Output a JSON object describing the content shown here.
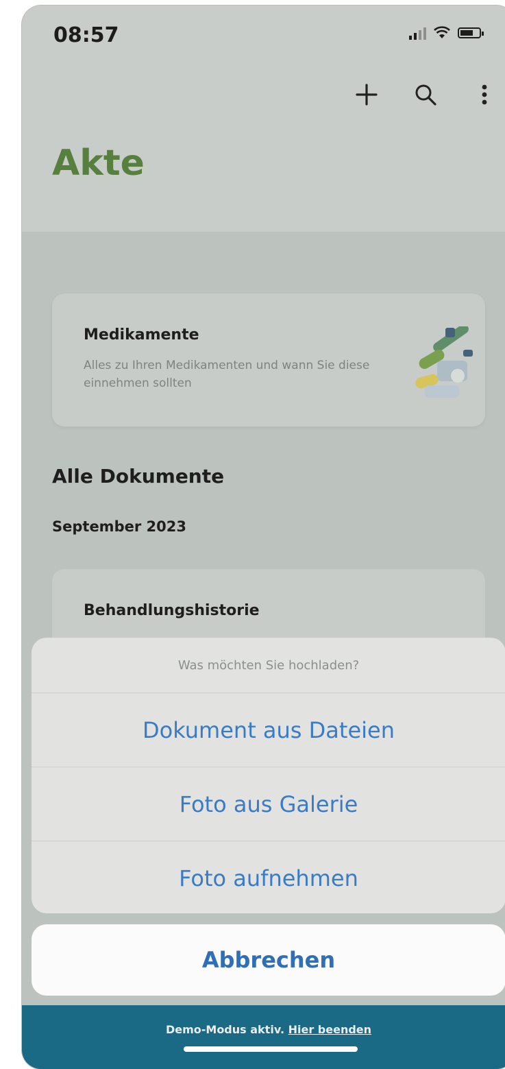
{
  "status_bar": {
    "time": "08:57"
  },
  "toolbar": {
    "add_icon": "plus-icon",
    "search_icon": "search-icon",
    "more_icon": "more-vertical-icon"
  },
  "page": {
    "title": "Akte",
    "title_color": "#577f3d"
  },
  "medication_card": {
    "title": "Medikamente",
    "description": "Alles zu Ihren Medikamenten und wann Sie diese einnehmen sollten",
    "illustration_icon": "pills-illustration"
  },
  "documents": {
    "section_title": "Alle Dokumente",
    "month": "September 2023",
    "items": [
      {
        "title": "Behandlungshistorie"
      }
    ]
  },
  "action_sheet": {
    "prompt": "Was möchten Sie hochladen?",
    "options": [
      {
        "label": "Dokument aus Dateien"
      },
      {
        "label": "Foto aus Galerie"
      },
      {
        "label": "Foto aufnehmen"
      }
    ],
    "cancel_label": "Abbrechen",
    "option_color": "#3a7bc6"
  },
  "demo_banner": {
    "text": "Demo-Modus aktiv.",
    "link": "Hier beenden",
    "background": "#1a6a85"
  }
}
